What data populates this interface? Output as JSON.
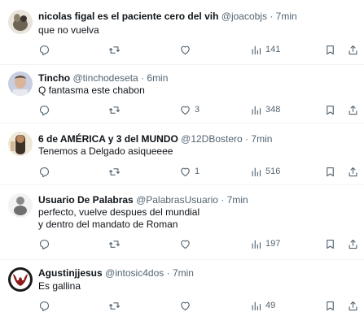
{
  "tweets": [
    {
      "name": "nicolas figal es el paciente cero del vih",
      "handle": "@joacobjs",
      "time": "7min",
      "lines": [
        "que no vuelva"
      ],
      "replies": "",
      "retweets": "",
      "likes": "",
      "views": "141"
    },
    {
      "name": "Tincho",
      "handle": "@tinchodeseta",
      "time": "6min",
      "lines": [
        "Q fantasma este chabon"
      ],
      "replies": "",
      "retweets": "",
      "likes": "3",
      "views": "348"
    },
    {
      "name": "6 de AMÉRICA y 3 del MUNDO",
      "handle": "@12DBostero",
      "time": "7min",
      "lines": [
        "Tenemos a Delgado asiqueeee"
      ],
      "replies": "",
      "retweets": "",
      "likes": "1",
      "views": "516"
    },
    {
      "name": "Usuario De Palabras",
      "handle": "@PalabrasUsuario",
      "time": "7min",
      "lines": [
        "perfecto, vuelve despues del mundial",
        "y dentro del mandato de Roman"
      ],
      "replies": "",
      "retweets": "",
      "likes": "",
      "views": "197"
    },
    {
      "name": "Agustinjjesus",
      "handle": "@intosic4dos",
      "time": "7min",
      "lines": [
        "Es gallina"
      ],
      "replies": "",
      "retweets": "",
      "likes": "",
      "views": "49"
    }
  ],
  "separator": "·",
  "icons": {
    "reply": "reply-icon",
    "retweet": "retweet-icon",
    "like": "heart-icon",
    "views": "views-chart-icon",
    "bookmark": "bookmark-icon",
    "share": "share-icon"
  },
  "colors": {
    "text": "#0f1419",
    "secondary": "#536471",
    "divider": "#eff3f4"
  }
}
